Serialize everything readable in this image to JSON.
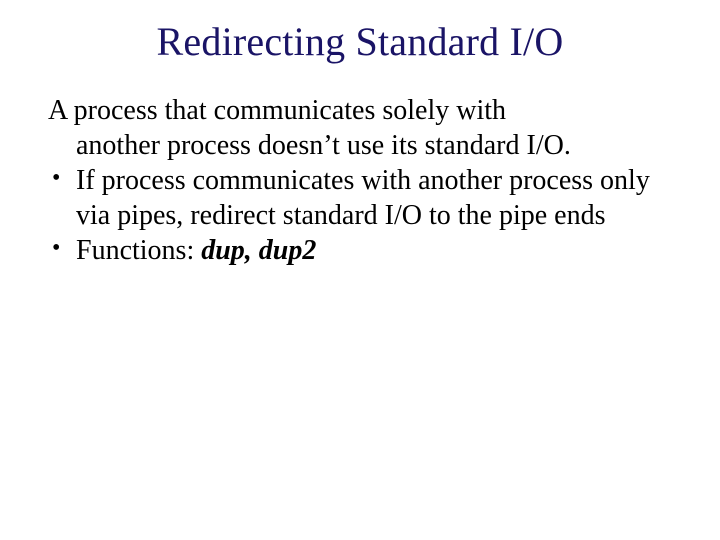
{
  "title": "Redirecting Standard I/O",
  "intro_line1": "A process that communicates solely with",
  "intro_line2": "another process doesn’t use its standard I/O.",
  "bullets": [
    "If process communicates with another process only via pipes, redirect standard I/O to  the pipe ends"
  ],
  "functions_label": "Functions: ",
  "functions_names": "dup, dup2"
}
